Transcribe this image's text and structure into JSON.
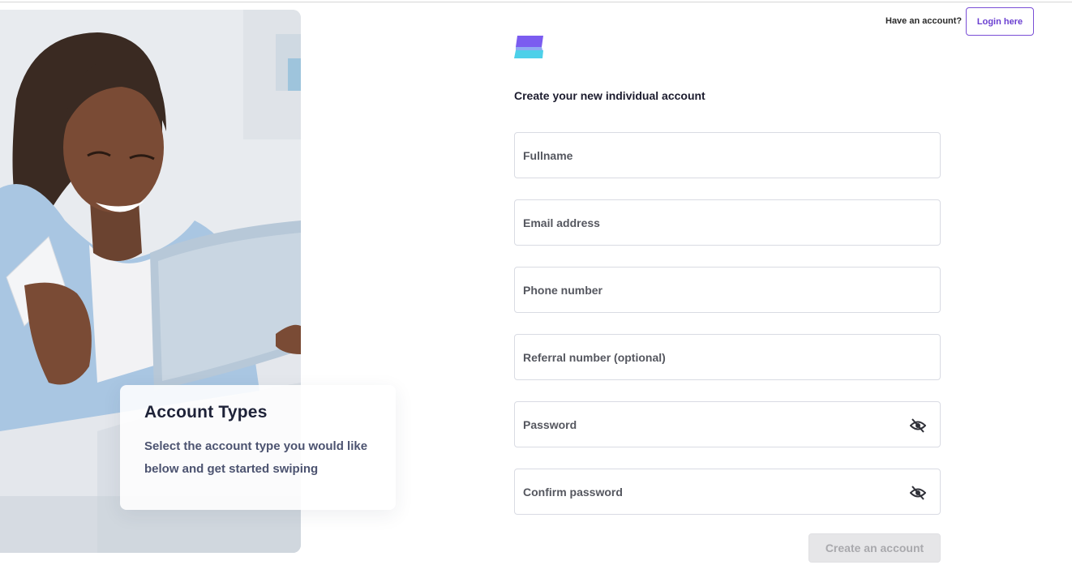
{
  "header": {
    "have_account_text": "Have an account?",
    "login_label": "Login here"
  },
  "brand": {
    "logo_icon": "brand-logo-icon",
    "colors": {
      "top": "#7b5cf0",
      "bottom": "#4dd0e9"
    }
  },
  "hero": {
    "image_description_icon": "woman-with-card-photo",
    "card": {
      "title": "Account Types",
      "text": "Select the account type you would like below and get started swiping"
    }
  },
  "form": {
    "title": "Create your new individual account",
    "fields": [
      {
        "label": "Fullname"
      },
      {
        "label": "Email address"
      },
      {
        "label": "Phone number"
      },
      {
        "label": "Referral number (optional)"
      },
      {
        "label": "Password",
        "icon": "eye-off-icon"
      },
      {
        "label": "Confirm password",
        "icon": "eye-off-icon"
      }
    ],
    "submit_label": "Create an account"
  },
  "colors": {
    "accent": "#6a3fd0",
    "border": "#d9dbe3",
    "disabled_bg": "#e6e6e8"
  }
}
